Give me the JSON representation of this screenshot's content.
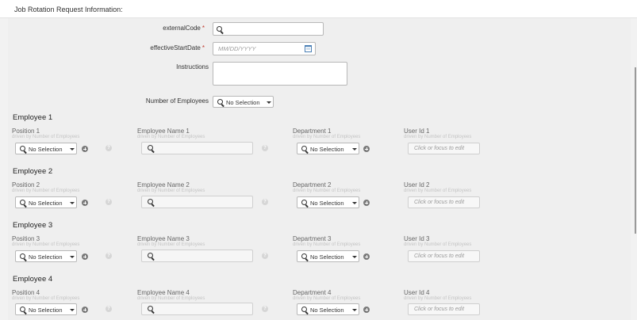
{
  "header": {
    "title": "Job Rotation Request Information:"
  },
  "form": {
    "external_code": {
      "label": "externalCode",
      "required_mark": "*",
      "value": ""
    },
    "effective_start_date": {
      "label": "effectiveStartDate",
      "required_mark": "*",
      "placeholder": "MM/DD/YYYY"
    },
    "instructions": {
      "label": "Instructions",
      "value": ""
    },
    "number_of_employees": {
      "label": "Number of Employees",
      "value": "No Selection"
    }
  },
  "employees": [
    {
      "title": "Employee 1",
      "position_label": "Position 1",
      "name_label": "Employee Name 1",
      "department_label": "Department 1",
      "userid_label": "User Id 1"
    },
    {
      "title": "Employee 2",
      "position_label": "Position 2",
      "name_label": "Employee Name 2",
      "department_label": "Department 2",
      "userid_label": "User Id 2"
    },
    {
      "title": "Employee 3",
      "position_label": "Position 3",
      "name_label": "Employee Name 3",
      "department_label": "Department 3",
      "userid_label": "User Id 3"
    },
    {
      "title": "Employee 4",
      "position_label": "Position 4",
      "name_label": "Employee Name 4",
      "department_label": "Department 4",
      "userid_label": "User Id 4"
    }
  ],
  "common": {
    "driven_hint": "driven by Number of Employees",
    "no_selection": "No Selection",
    "edit_placeholder": "Click or focus to edit",
    "help_glyph": "?"
  },
  "icons": {
    "search": "search-icon",
    "calendar": "calendar-icon",
    "dropdown": "chevron-down-icon",
    "add": "plus-icon",
    "help": "help-icon"
  }
}
